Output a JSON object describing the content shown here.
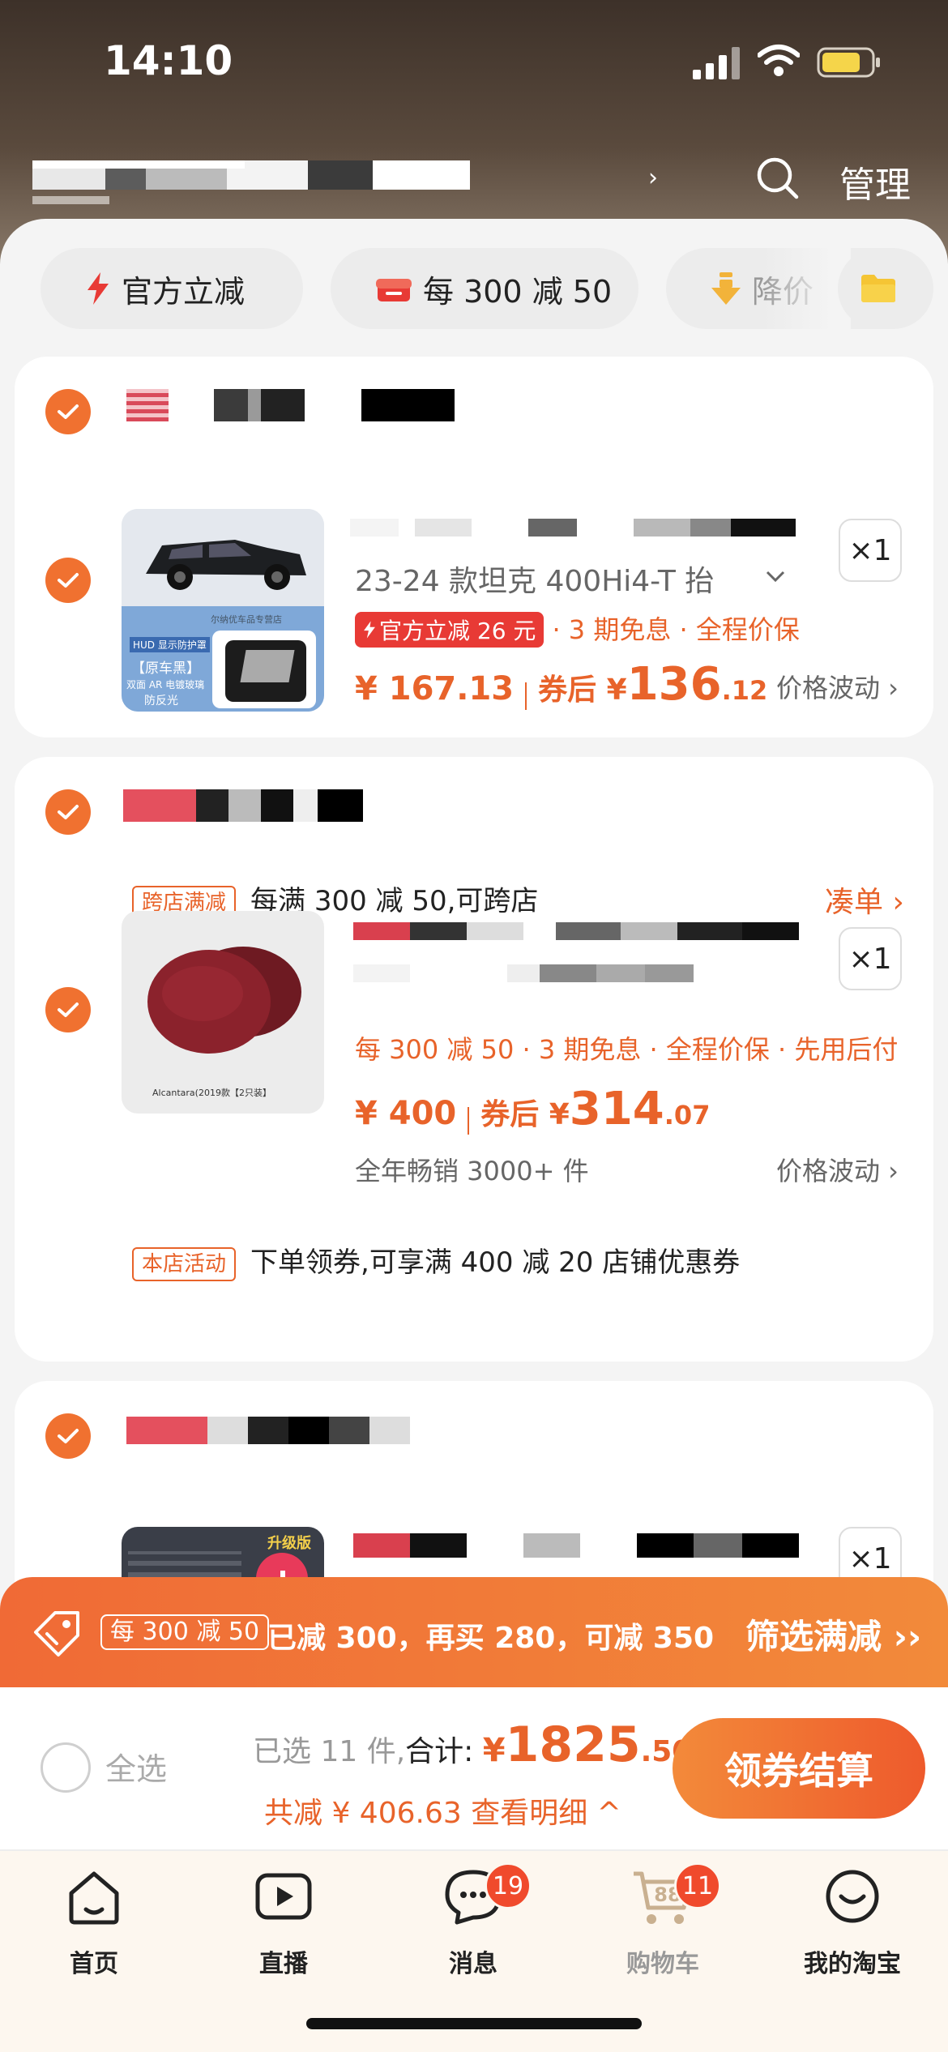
{
  "status_bar": {
    "time": "14:10"
  },
  "nav": {
    "manage_label": "管理",
    "chevron": "›"
  },
  "filters": [
    {
      "label": "官方立减",
      "icon": "bolt-icon"
    },
    {
      "label": "每 300 减 50",
      "icon": "gift-box-icon"
    },
    {
      "label": "降价",
      "icon": "arrow-down-icon"
    }
  ],
  "items": [
    {
      "qty": "×1",
      "spec": "23-24 款坦克 400Hi4-T 抬",
      "badge": "官方立减 26 元",
      "promo": "· 3 期免息 · 全程价保",
      "price": "¥ 167.13",
      "after_label": "券后 ¥",
      "after_int": "136",
      "after_dec": ".12",
      "price_link": "价格波动 ›",
      "thumb": {
        "hud_label": "HUD 显示防护罩",
        "shop_label": "尔纳优车品专营店",
        "tag1": "【原车黑】",
        "tag2": "双面 AR 电镀玻璃",
        "tag3": "防反光"
      }
    },
    {
      "shop_promo_tag": "跨店满减",
      "shop_promo_text": "每满 300 减 50,可跨店",
      "shop_promo_link": "凑单 ›",
      "qty": "×1",
      "promo": "每 300 减 50 · 3 期免息 · 全程价保 · 先用后付",
      "price": "¥ 400",
      "after_label": "券后 ¥",
      "after_int": "314",
      "after_dec": ".07",
      "sales": "全年畅销 3000+ 件",
      "price_link": "价格波动 ›",
      "thumb_caption": "Alcantara(2019款【2只装】",
      "store_tag": "本店活动",
      "store_text": "下单领券,可享满 400 减 20 店铺优惠券"
    },
    {
      "qty": "×1",
      "thumb_badge": "升级版"
    }
  ],
  "banner": {
    "tag": "每 300 减 50",
    "text": "已减 300，再买 280，可减 350",
    "right": "筛选满减 ››"
  },
  "checkout": {
    "select_all": "全选",
    "selected_prefix": "已选 11 件,",
    "total_label": "合计:",
    "currency": "¥",
    "total_int": "1825",
    "total_dec": ".50",
    "discount": "共减 ¥ 406.63  查看明细 ^",
    "button": "领券结算"
  },
  "tabs": [
    {
      "label": "首页",
      "icon": "home-icon"
    },
    {
      "label": "直播",
      "icon": "live-play-icon"
    },
    {
      "label": "消息",
      "icon": "message-icon",
      "badge": "19"
    },
    {
      "label": "购物车",
      "icon": "cart-icon",
      "badge": "11",
      "cart_count": "88"
    },
    {
      "label": "我的淘宝",
      "icon": "smile-icon"
    }
  ],
  "colors": {
    "accent": "#f07130",
    "price": "#e8632a",
    "badge_red": "#e83a35"
  }
}
